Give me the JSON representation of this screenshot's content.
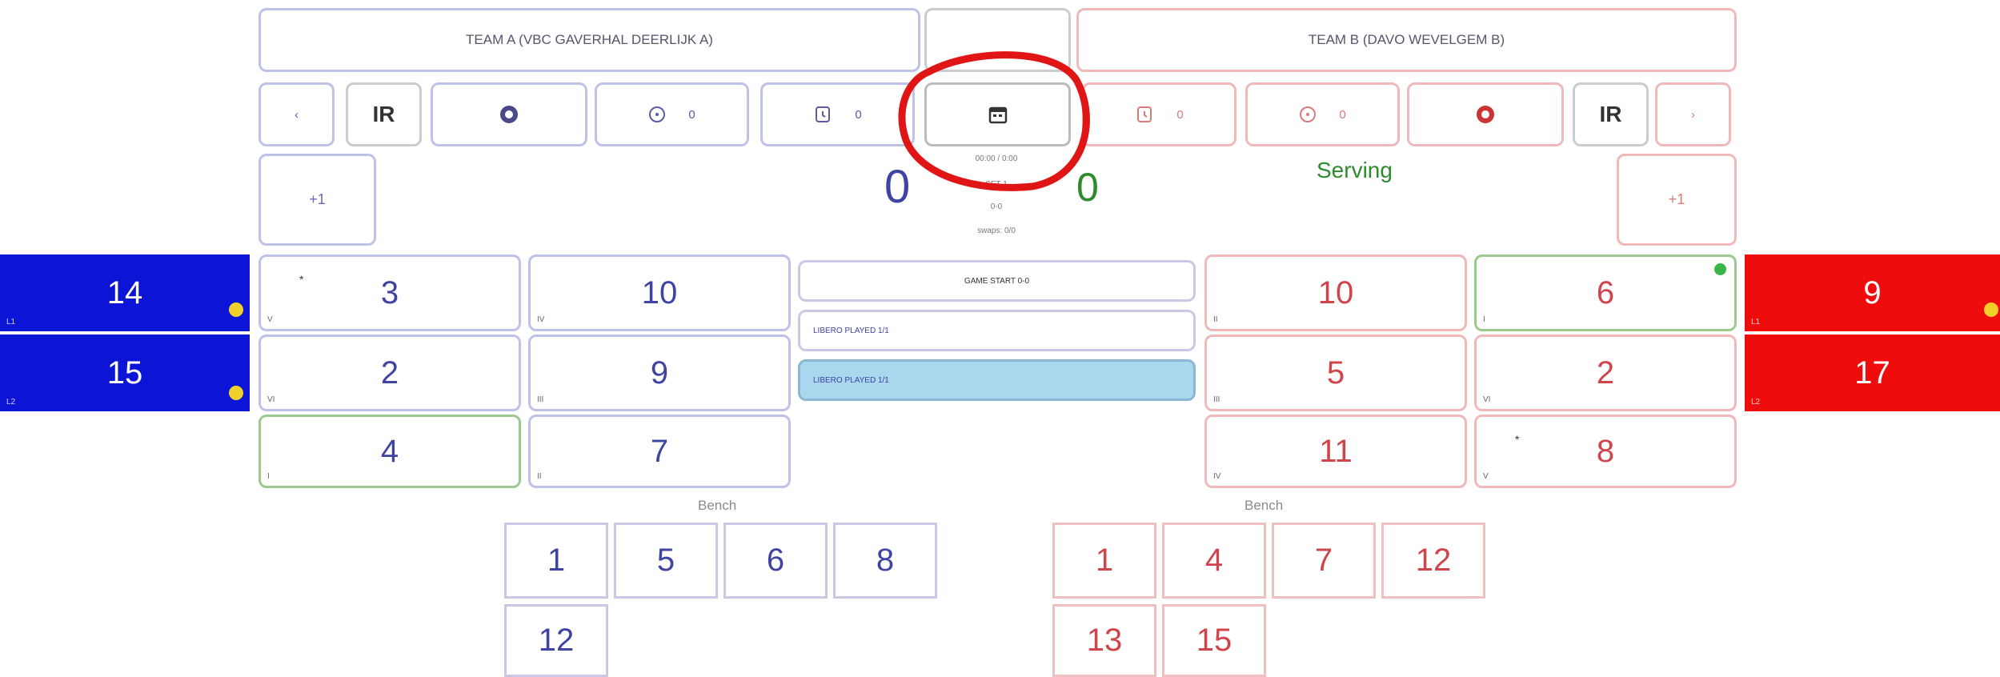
{
  "team_a": {
    "name": "TEAM A (VBC GAVERHAL DEERLIJK A)",
    "ir_label": "IR",
    "timeout_count": "0",
    "sub_count": "0",
    "plus_one": "+1",
    "score": "0",
    "court": [
      {
        "number": "3",
        "position": "V",
        "captain": "*"
      },
      {
        "number": "10",
        "position": "IV"
      },
      {
        "number": "2",
        "position": "VI"
      },
      {
        "number": "9",
        "position": "III"
      },
      {
        "number": "4",
        "position": "I"
      },
      {
        "number": "7",
        "position": "II"
      }
    ],
    "liberos": [
      {
        "number": "14",
        "tag": "L1"
      },
      {
        "number": "15",
        "tag": "L2"
      }
    ],
    "bench_label": "Bench",
    "bench": [
      "1",
      "5",
      "6",
      "8",
      "12"
    ]
  },
  "team_b": {
    "name": "TEAM B (DAVO WEVELGEM B)",
    "ir_label": "IR",
    "timeout_count": "0",
    "sub_count": "0",
    "plus_one": "+1",
    "score": "0",
    "serving_label": "Serving",
    "court": [
      {
        "number": "10",
        "position": "II"
      },
      {
        "number": "6",
        "position": "I"
      },
      {
        "number": "5",
        "position": "III"
      },
      {
        "number": "2",
        "position": "VI"
      },
      {
        "number": "11",
        "position": "IV"
      },
      {
        "number": "8",
        "position": "V",
        "captain": "*"
      }
    ],
    "liberos": [
      {
        "number": "9",
        "tag": "L1"
      },
      {
        "number": "17",
        "tag": "L2"
      }
    ],
    "bench_label": "Bench",
    "bench": [
      "1",
      "4",
      "7",
      "12",
      "13",
      "15"
    ]
  },
  "center": {
    "info_lines": [
      "00:00 / 0:00",
      "SET 1",
      "0-0",
      "swaps: 0/0"
    ],
    "log": [
      "GAME START 0-0",
      "LIBERO PLAYED 1/1",
      "LIBERO PLAYED 1/1"
    ]
  },
  "colors": {
    "team_a": "#0c15d6",
    "team_b": "#ee0c0c",
    "highlight": "#a9d7ee",
    "annotation": "#e01616"
  }
}
